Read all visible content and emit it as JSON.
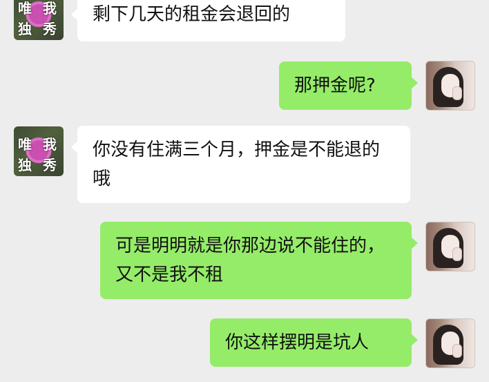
{
  "messages": [
    {
      "side": "left",
      "text": "剩下几天的租金会退回的"
    },
    {
      "side": "right",
      "text": "那押金呢?"
    },
    {
      "side": "left",
      "text": "你没有住满三个月，押金是不能退的哦"
    },
    {
      "side": "right",
      "text": "可是明明就是你那边说不能住的，又不是我不租"
    },
    {
      "side": "right",
      "text": "你这样摆明是坑人"
    }
  ],
  "contact_avatar": {
    "text_1": "唯",
    "text_2": "我",
    "text_3": "独",
    "text_4": "秀"
  }
}
